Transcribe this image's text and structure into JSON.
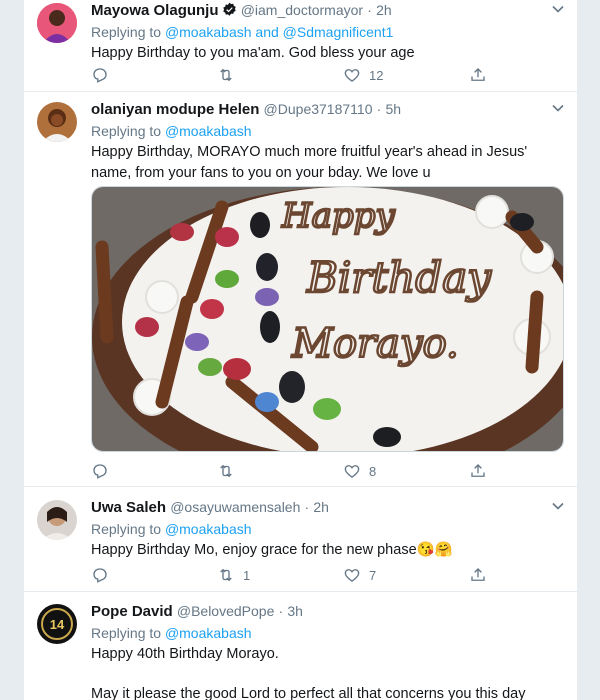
{
  "tweets": [
    {
      "name": "Mayowa Olagunju",
      "handle": "@iam_doctormayor",
      "time": "2h",
      "replying_label": "Replying to",
      "mention1": "@moakabash",
      "and_label": "and",
      "mention2": "@Sdmagnificent1",
      "text": "Happy Birthday to you ma'am. God bless your age",
      "likes": "12"
    },
    {
      "name": "olaniyan modupe Helen",
      "handle": "@Dupe37187110",
      "time": "5h",
      "replying_label": "Replying to",
      "mention1": "@moakabash",
      "text": "Happy Birthday, MORAYO much more fruitful year's ahead in Jesus' name, from your fans to you on your bday. We love u",
      "likes": "8",
      "image_text": [
        "Happy",
        "Birthday",
        "Morayo."
      ]
    },
    {
      "name": "Uwa Saleh",
      "handle": "@osayuwamensaleh",
      "time": "2h",
      "replying_label": "Replying to",
      "mention1": "@moakabash",
      "text": "Happy Birthday Mo, enjoy grace for the new phase😘🤗",
      "retweets": "1",
      "likes": "7"
    },
    {
      "name": "Pope David",
      "handle": "@BelovedPope",
      "time": "3h",
      "replying_label": "Replying to",
      "mention1": "@moakabash",
      "text": "Happy 40th Birthday Morayo.",
      "text2": "May it please the good Lord to perfect all that concerns you this day"
    }
  ],
  "separator": "·",
  "colors": {
    "link": "#1da1f2",
    "muted": "#657786",
    "border": "#e6ecf0",
    "verified": "#1da1f2"
  },
  "icons": [
    "reply-icon",
    "retweet-icon",
    "like-icon",
    "share-icon",
    "caret-down-icon",
    "verified-icon"
  ]
}
